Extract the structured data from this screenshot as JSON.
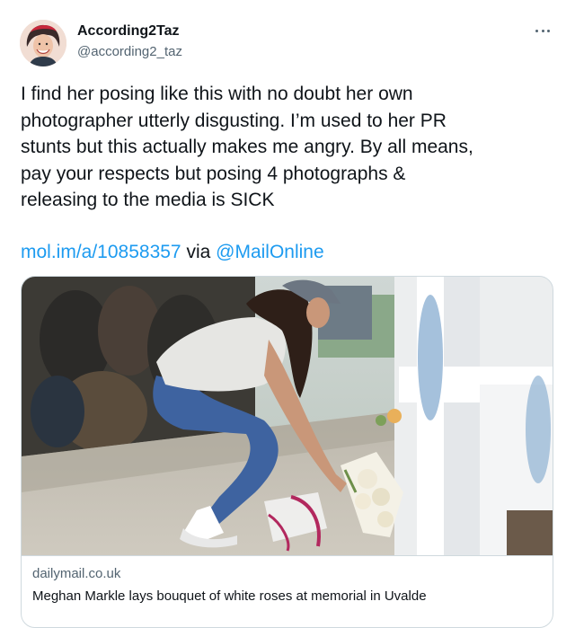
{
  "author": {
    "name": "According2Taz",
    "handle": "@according2_taz",
    "avatar_icon": "profile-avatar"
  },
  "more_icon": "more-horizontal-icon",
  "tweet": {
    "lines": [
      "I find her posing like this with no doubt her own",
      "photographer utterly disgusting. I’m used to her PR",
      "stunts but this actually makes me angry. By all means,",
      "pay your respects but posing 4 photographs &",
      "releasing to the media is SICK"
    ],
    "link_url_text": "mol.im/a/10858357",
    "via_text": " via ",
    "mention": "@MailOnline"
  },
  "card": {
    "domain": "dailymail.co.uk",
    "title": "Meghan Markle lays bouquet of white roses at memorial in Uvalde",
    "photo_alt": "Woman crouching to lay a bouquet of white roses at a memorial"
  },
  "colors": {
    "link": "#1d9bf0",
    "text": "#0f1419",
    "secondary": "#536471",
    "border": "#cfd9de"
  }
}
